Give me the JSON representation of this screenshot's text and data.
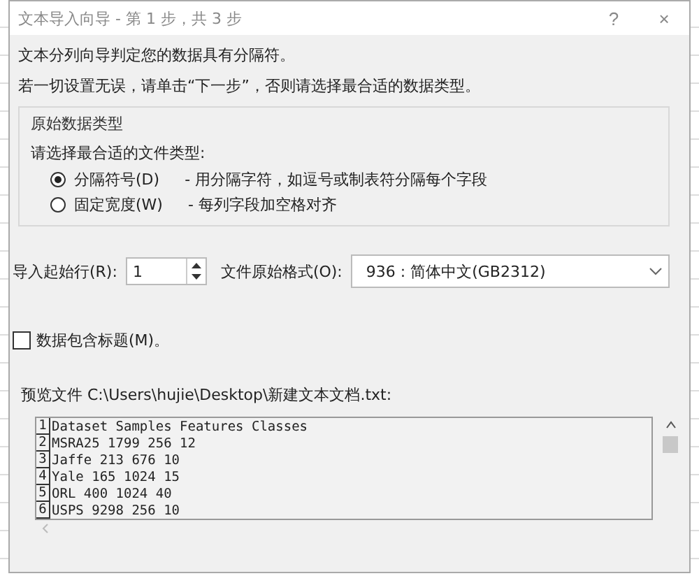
{
  "window": {
    "title": "文本导入向导 - 第 1 步，共 3 步",
    "help": "?",
    "close": "×"
  },
  "intro": [
    "文本分列向导判定您的数据具有分隔符。",
    "若一切设置无误，请单击“下一步”，否则请选择最合适的数据类型。"
  ],
  "group": {
    "legend": "原始数据类型",
    "prompt": "请选择最合适的文件类型:",
    "options": [
      {
        "label": "分隔符号(D)",
        "desc": "- 用分隔字符，如逗号或制表符分隔每个字段",
        "selected": true
      },
      {
        "label": "固定宽度(W)",
        "desc": "- 每列字段加空格对齐",
        "selected": false
      }
    ]
  },
  "start_row": {
    "label": "导入起始行(R):",
    "value": "1"
  },
  "encoding": {
    "label": "文件原始格式(O):",
    "value": "936 : 简体中文(GB2312)"
  },
  "headers_checkbox": {
    "label": "数据包含标题(M)。",
    "checked": false
  },
  "preview": {
    "label": "预览文件 C:\\Users\\hujie\\Desktop\\新建文本文档.txt:",
    "rows": [
      {
        "number": "1",
        "text": "Dataset Samples Features Classes"
      },
      {
        "number": "2",
        "text": "MSRA25 1799 256 12"
      },
      {
        "number": "3",
        "text": "Jaffe 213 676 10"
      },
      {
        "number": "4",
        "text": "Yale 165 1024 15"
      },
      {
        "number": "5",
        "text": "ORL 400 1024 40"
      },
      {
        "number": "6",
        "text": "USPS 9298 256 10"
      }
    ]
  }
}
